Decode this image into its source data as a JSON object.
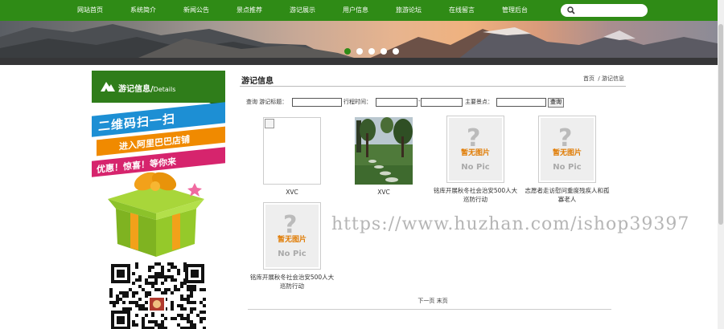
{
  "nav": {
    "items": [
      "网站首页",
      "系统简介",
      "新闻公告",
      "景点推荐",
      "游记展示",
      "用户信息",
      "旅游论坛",
      "在线留言",
      "管理后台"
    ],
    "search_placeholder": ""
  },
  "banner": {
    "slides": 5,
    "active_slide": 0
  },
  "sidebar": {
    "title": "游记信息/",
    "title_en": "Details",
    "promo_line1": "二维码扫一扫",
    "promo_line2": "进入阿里巴巴店铺",
    "promo_line3": "优惠！惊喜！等你来"
  },
  "main": {
    "title": "游记信息",
    "breadcrumb_home": "首页",
    "breadcrumb_sep": "/",
    "breadcrumb_current": "游记信息",
    "filters": {
      "query_label": "查询 游记标题：",
      "date_label": "行程时间：",
      "date_sep": "-",
      "spot_label": "主要景点：",
      "search_button": "查询"
    },
    "cards": [
      {
        "caption": "XVC",
        "image": "broken"
      },
      {
        "caption": "XVC",
        "image": "photo"
      },
      {
        "caption": "铭库开展秋冬社会治安500人大巡防行动",
        "image": "placeholder"
      },
      {
        "caption": "志愿者走访慰问重度残疾人和孤寡老人",
        "image": "placeholder"
      },
      {
        "caption": "铭库开展秋冬社会治安500人大巡防行动",
        "image": "placeholder"
      }
    ],
    "placeholder_text": "暂无图片",
    "placeholder_sub": "No Pic",
    "placeholder_mark": "?",
    "pager": "下一页 末页"
  },
  "watermark": "https://www.huzhan.com/ishop39397",
  "colors": {
    "nav_green": "#2f8b16",
    "sidebar_green": "#2f7d1a",
    "placeholder_orange": "#e07a00"
  }
}
